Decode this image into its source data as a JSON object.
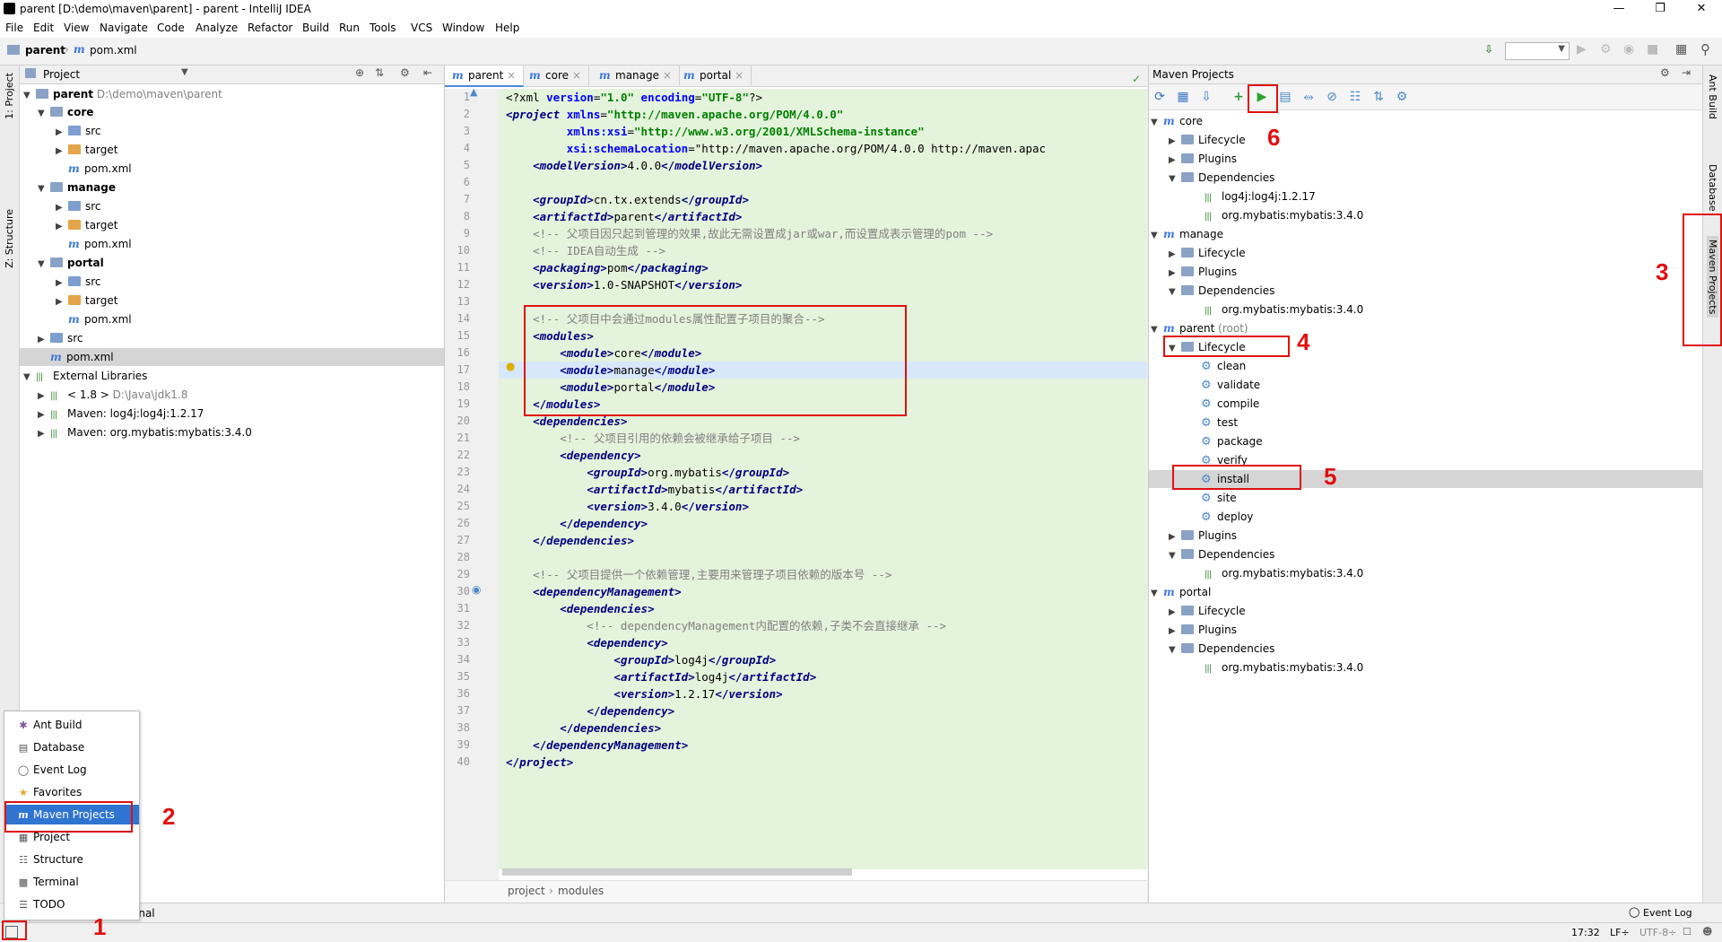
{
  "window": {
    "title": "parent [D:\\demo\\maven\\parent] - parent - IntelliJ IDEA"
  },
  "menu": [
    "File",
    "Edit",
    "View",
    "Navigate",
    "Code",
    "Analyze",
    "Refactor",
    "Build",
    "Run",
    "Tools",
    "VCS",
    "Window",
    "Help"
  ],
  "nav": {
    "crumb1": "parent",
    "crumb2": "pom.xml"
  },
  "left_strip": {
    "project": "1: Project",
    "structure": "Z: Structure"
  },
  "right_strip": {
    "ant": "Ant Build",
    "database": "Database",
    "maven": "Maven Projects"
  },
  "project_panel": {
    "title": "Project",
    "rows": [
      {
        "label": "parent",
        "path": "D:\\demo\\maven\\parent"
      },
      {
        "label": "core"
      },
      {
        "label": "src"
      },
      {
        "label": "target"
      },
      {
        "label": "pom.xml"
      },
      {
        "label": "manage"
      },
      {
        "label": "src"
      },
      {
        "label": "target"
      },
      {
        "label": "pom.xml"
      },
      {
        "label": "portal"
      },
      {
        "label": "src"
      },
      {
        "label": "target"
      },
      {
        "label": "pom.xml"
      },
      {
        "label": "src"
      },
      {
        "label": "pom.xml"
      },
      {
        "label": "External Libraries"
      },
      {
        "label": "< 1.8 >",
        "path": "D:\\Java\\jdk1.8"
      },
      {
        "label": "Maven: log4j:log4j:1.2.17"
      },
      {
        "label": "Maven: org.mybatis:mybatis:3.4.0"
      }
    ]
  },
  "editor": {
    "tabs": [
      "parent",
      "core",
      "manage",
      "portal"
    ],
    "lines": [
      "<?xml version=\"1.0\" encoding=\"UTF-8\"?>",
      "<project xmlns=\"http://maven.apache.org/POM/4.0.0\"",
      "         xmlns:xsi=\"http://www.w3.org/2001/XMLSchema-instance\"",
      "         xsi:schemaLocation=\"http://maven.apache.org/POM/4.0.0 http://maven.apac",
      "    <modelVersion>4.0.0</modelVersion>",
      "",
      "    <groupId>cn.tx.extends</groupId>",
      "    <artifactId>parent</artifactId>",
      "    <!-- 父项目因只起到管理的效果,故此无需设置成jar或war,而设置成表示管理的pom -->",
      "    <!-- IDEA自动生成 -->",
      "    <packaging>pom</packaging>",
      "    <version>1.0-SNAPSHOT</version>",
      "",
      "    <!-- 父项目中会通过modules属性配置子项目的聚合-->",
      "    <modules>",
      "        <module>core</module>",
      "        <module>manage</module>",
      "        <module>portal</module>",
      "    </modules>",
      "    <dependencies>",
      "        <!-- 父项目引用的依赖会被继承给子项目 -->",
      "        <dependency>",
      "            <groupId>org.mybatis</groupId>",
      "            <artifactId>mybatis</artifactId>",
      "            <version>3.4.0</version>",
      "        </dependency>",
      "    </dependencies>",
      "",
      "    <!-- 父项目提供一个依赖管理,主要用来管理子项目依赖的版本号 -->",
      "    <dependencyManagement>",
      "        <dependencies>",
      "            <!-- dependencyManagement内配置的依赖,子类不会直接继承 -->",
      "            <dependency>",
      "                <groupId>log4j</groupId>",
      "                <artifactId>log4j</artifactId>",
      "                <version>1.2.17</version>",
      "            </dependency>",
      "        </dependencies>",
      "    </dependencyManagement>",
      "</project>"
    ],
    "breadcrumb": [
      "project",
      "modules"
    ]
  },
  "maven_panel": {
    "title": "Maven Projects",
    "tree": [
      {
        "label": "core"
      },
      {
        "label": "Lifecycle"
      },
      {
        "label": "Plugins"
      },
      {
        "label": "Dependencies"
      },
      {
        "label": "log4j:log4j:1.2.17"
      },
      {
        "label": "org.mybatis:mybatis:3.4.0"
      },
      {
        "label": "manage"
      },
      {
        "label": "Lifecycle"
      },
      {
        "label": "Plugins"
      },
      {
        "label": "Dependencies"
      },
      {
        "label": "org.mybatis:mybatis:3.4.0"
      },
      {
        "label": "parent",
        "suffix": "(root)"
      },
      {
        "label": "Lifecycle"
      },
      {
        "label": "clean"
      },
      {
        "label": "validate"
      },
      {
        "label": "compile"
      },
      {
        "label": "test"
      },
      {
        "label": "package"
      },
      {
        "label": "verify"
      },
      {
        "label": "install"
      },
      {
        "label": "site"
      },
      {
        "label": "deploy"
      },
      {
        "label": "Plugins"
      },
      {
        "label": "Dependencies"
      },
      {
        "label": "org.mybatis:mybatis:3.4.0"
      },
      {
        "label": "portal"
      },
      {
        "label": "Lifecycle"
      },
      {
        "label": "Plugins"
      },
      {
        "label": "Dependencies"
      },
      {
        "label": "org.mybatis:mybatis:3.4.0"
      }
    ]
  },
  "popup": {
    "items": [
      "Ant Build",
      "Database",
      "Event Log",
      "Favorites",
      "Maven Projects",
      "Project",
      "Structure",
      "Terminal",
      "TODO"
    ]
  },
  "bottom": {
    "partial_tab": "inal",
    "event_log": "Event Log"
  },
  "status": {
    "pos": "17:32",
    "lf": "LF÷",
    "enc": "UTF-8÷"
  },
  "annotations": [
    "1",
    "2",
    "3",
    "4",
    "5",
    "6"
  ]
}
